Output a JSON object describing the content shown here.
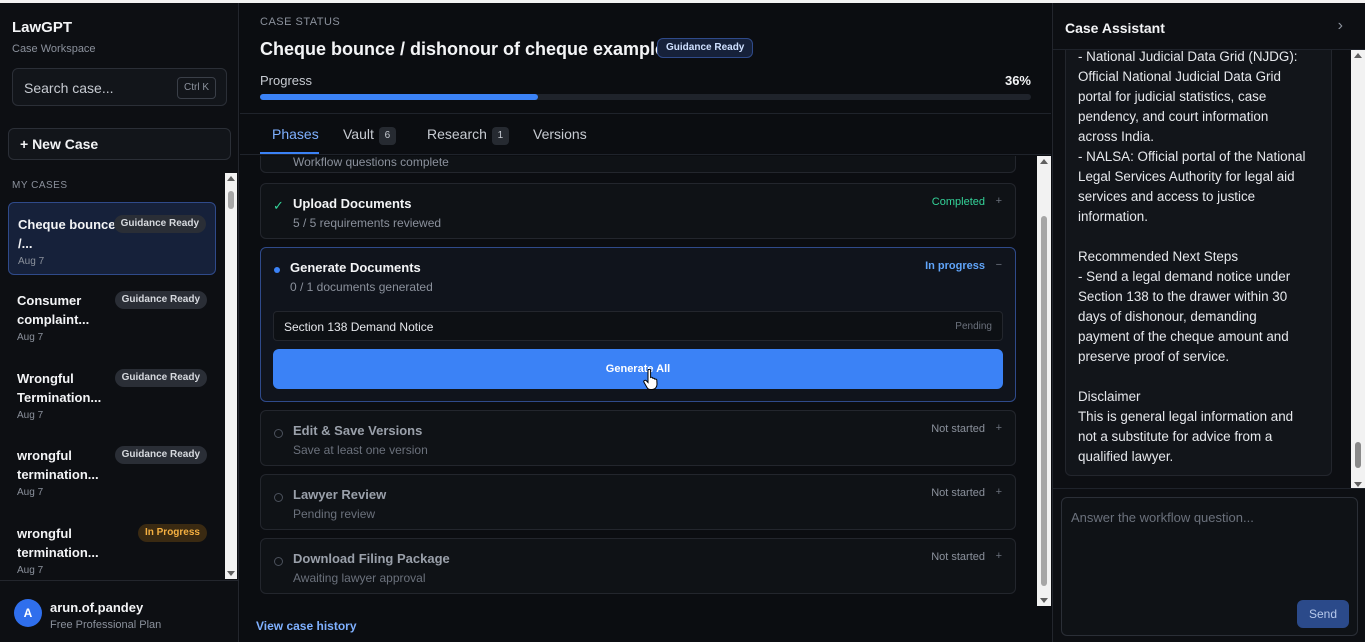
{
  "sidebar": {
    "brand": "LawGPT",
    "subtitle": "Case Workspace",
    "search_placeholder": "Search case...",
    "search_shortcut": "Ctrl K",
    "new_case_label": "+ New Case",
    "section_label": "MY CASES",
    "cases": [
      {
        "title": "Cheque bounce /...",
        "date": "Aug 7",
        "badge": "Guidance Ready"
      },
      {
        "title": "Consumer complaint...",
        "date": "Aug 7",
        "badge": "Guidance Ready"
      },
      {
        "title": "Wrongful Termination...",
        "date": "Aug 7",
        "badge": "Guidance Ready"
      },
      {
        "title": "wrongful termination...",
        "date": "Aug 7",
        "badge": "Guidance Ready"
      },
      {
        "title": "wrongful termination...",
        "date": "Aug 7",
        "badge": "In Progress"
      }
    ],
    "user": {
      "initial": "A",
      "name": "arun.of.pandey",
      "plan": "Free Professional Plan"
    }
  },
  "main": {
    "status_label": "CASE STATUS",
    "case_title": "Cheque bounce / dishonour of cheque example",
    "case_badge": "Guidance Ready",
    "progress_label": "Progress",
    "progress_text": "36%",
    "progress_value": 0.36,
    "tabs": [
      {
        "label": "Phases",
        "count": ""
      },
      {
        "label": "Vault",
        "count": "6"
      },
      {
        "label": "Research",
        "count": "1"
      },
      {
        "label": "Versions",
        "count": ""
      }
    ],
    "phases": [
      {
        "title": "",
        "subtitle": "Workflow questions complete",
        "status": "",
        "toggle": ""
      },
      {
        "title": "Upload Documents",
        "subtitle": "5 / 5 requirements reviewed",
        "status": "Completed",
        "toggle": "+"
      },
      {
        "title": "Generate Documents",
        "subtitle": "0 / 1 documents generated",
        "status": "In progress",
        "toggle": "−"
      },
      {
        "title": "Edit & Save Versions",
        "subtitle": "Save at least one version",
        "status": "Not started",
        "toggle": "+"
      },
      {
        "title": "Lawyer Review",
        "subtitle": "Pending review",
        "status": "Not started",
        "toggle": "+"
      },
      {
        "title": "Download Filing Package",
        "subtitle": "Awaiting lawyer approval",
        "status": "Not started",
        "toggle": "+"
      }
    ],
    "document": {
      "name": "Section 138 Demand Notice",
      "state": "Pending"
    },
    "generate_all_label": "Generate All",
    "history_link": "View case history"
  },
  "assistant": {
    "title": "Case Assistant",
    "close_icon": "chevron-right-icon",
    "message_lines": [
      "- National Judicial Data Grid (NJDG):",
      "Official National Judicial Data Grid",
      "portal for judicial statistics, case",
      "pendency, and court information",
      "across India.",
      "- NALSA: Official portal of the National",
      "Legal Services Authority for legal aid",
      "services and access to justice",
      "information.",
      "",
      "Recommended Next Steps",
      "- Send a legal demand notice under",
      "Section 138 to the drawer within 30",
      "days of dishonour, demanding",
      "payment of the cheque amount and",
      "preserve proof of service.",
      "",
      "Disclaimer",
      "This is general legal information and",
      "not a substitute for advice from a",
      "qualified lawyer."
    ],
    "input_placeholder": "Answer the workflow question...",
    "send_label": "Send"
  },
  "colors": {
    "accent": "#3b82f6",
    "completed": "#34d399",
    "in_progress_badge": "#f5b041"
  }
}
